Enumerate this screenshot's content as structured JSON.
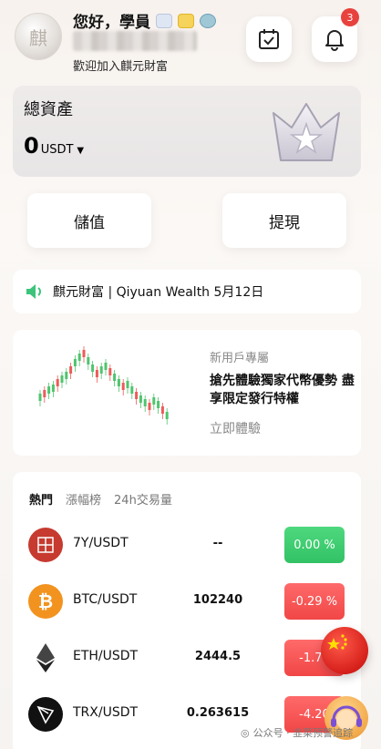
{
  "header": {
    "greeting": "您好，學員",
    "welcome": "歡迎加入麒元財富",
    "notification_count": "3"
  },
  "assets": {
    "title": "總資產",
    "value": "0",
    "unit": "USDT"
  },
  "actions": {
    "deposit_label": "儲值",
    "withdraw_label": "提現"
  },
  "announcement": {
    "text": "麒元財富 | Qiyuan Wealth 5月12日"
  },
  "promo": {
    "subtitle": "新用戶專屬",
    "title": "搶先體驗獨家代幣優勢 盡享限定發行特權",
    "link": "立即體驗"
  },
  "market": {
    "tabs": [
      "熱門",
      "漲幅榜",
      "24h交易量"
    ],
    "rows": [
      {
        "pair": "7Y/USDT",
        "price": "--",
        "change": "0.00 %",
        "trend": "up",
        "icon": "7y-coin-icon"
      },
      {
        "pair": "BTC/USDT",
        "price": "102240",
        "change": "-0.29 %",
        "trend": "down",
        "icon": "btc-icon"
      },
      {
        "pair": "ETH/USDT",
        "price": "2444.5",
        "change": "-1.70",
        "trend": "down",
        "icon": "eth-icon"
      },
      {
        "pair": "TRX/USDT",
        "price": "0.263615",
        "change": "-4.20",
        "trend": "down",
        "icon": "trx-icon"
      }
    ]
  },
  "watermark": "公众号 · 韭菜预警追踪",
  "colors": {
    "up": "#32c265",
    "down": "#f14646",
    "badge": "#e8423f"
  }
}
